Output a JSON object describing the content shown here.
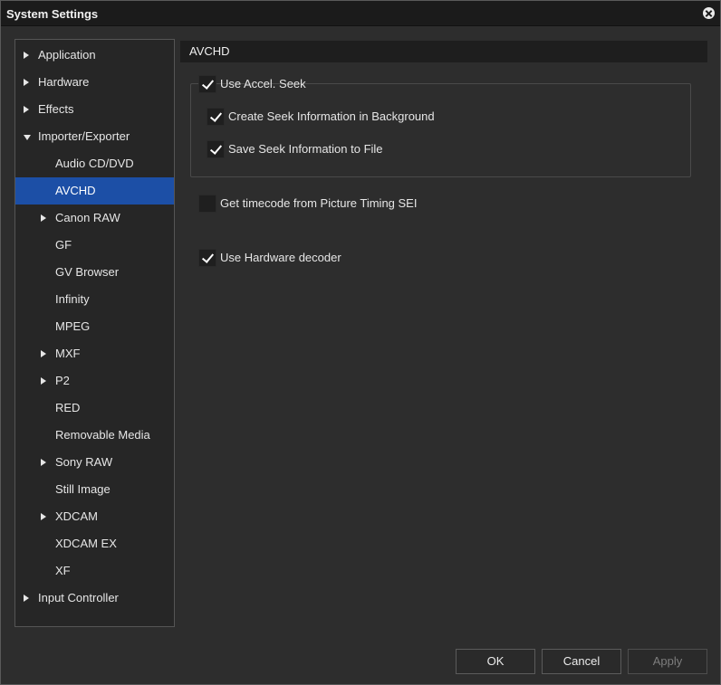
{
  "window": {
    "title": "System Settings"
  },
  "tree": {
    "items": [
      {
        "label": "Application",
        "level": 0,
        "arrow": "right"
      },
      {
        "label": "Hardware",
        "level": 0,
        "arrow": "right"
      },
      {
        "label": "Effects",
        "level": 0,
        "arrow": "right"
      },
      {
        "label": "Importer/Exporter",
        "level": 0,
        "arrow": "down"
      },
      {
        "label": "Audio CD/DVD",
        "level": 1,
        "arrow": ""
      },
      {
        "label": "AVCHD",
        "level": 1,
        "arrow": "",
        "selected": true
      },
      {
        "label": "Canon RAW",
        "level": 1,
        "arrow": "right"
      },
      {
        "label": "GF",
        "level": 1,
        "arrow": ""
      },
      {
        "label": "GV Browser",
        "level": 1,
        "arrow": ""
      },
      {
        "label": "Infinity",
        "level": 1,
        "arrow": ""
      },
      {
        "label": "MPEG",
        "level": 1,
        "arrow": ""
      },
      {
        "label": "MXF",
        "level": 1,
        "arrow": "right"
      },
      {
        "label": "P2",
        "level": 1,
        "arrow": "right"
      },
      {
        "label": "RED",
        "level": 1,
        "arrow": ""
      },
      {
        "label": "Removable Media",
        "level": 1,
        "arrow": ""
      },
      {
        "label": "Sony RAW",
        "level": 1,
        "arrow": "right"
      },
      {
        "label": "Still Image",
        "level": 1,
        "arrow": ""
      },
      {
        "label": "XDCAM",
        "level": 1,
        "arrow": "right"
      },
      {
        "label": "XDCAM EX",
        "level": 1,
        "arrow": ""
      },
      {
        "label": "XF",
        "level": 1,
        "arrow": ""
      },
      {
        "label": "Input Controller",
        "level": 0,
        "arrow": "right"
      }
    ]
  },
  "panel": {
    "header": "AVCHD",
    "use_accel_seek": {
      "label": "Use Accel. Seek",
      "checked": true
    },
    "create_seek_info": {
      "label": "Create Seek Information in Background",
      "checked": true
    },
    "save_seek_info": {
      "label": "Save Seek Information to File",
      "checked": true
    },
    "get_timecode": {
      "label": "Get timecode from Picture Timing SEI",
      "checked": false
    },
    "use_hw_decoder": {
      "label": "Use Hardware decoder",
      "checked": true
    }
  },
  "buttons": {
    "ok": "OK",
    "cancel": "Cancel",
    "apply": "Apply"
  },
  "colors": {
    "selection": "#1c4fa6",
    "background": "#2d2d2d",
    "title_bar": "#1b1b1b"
  }
}
